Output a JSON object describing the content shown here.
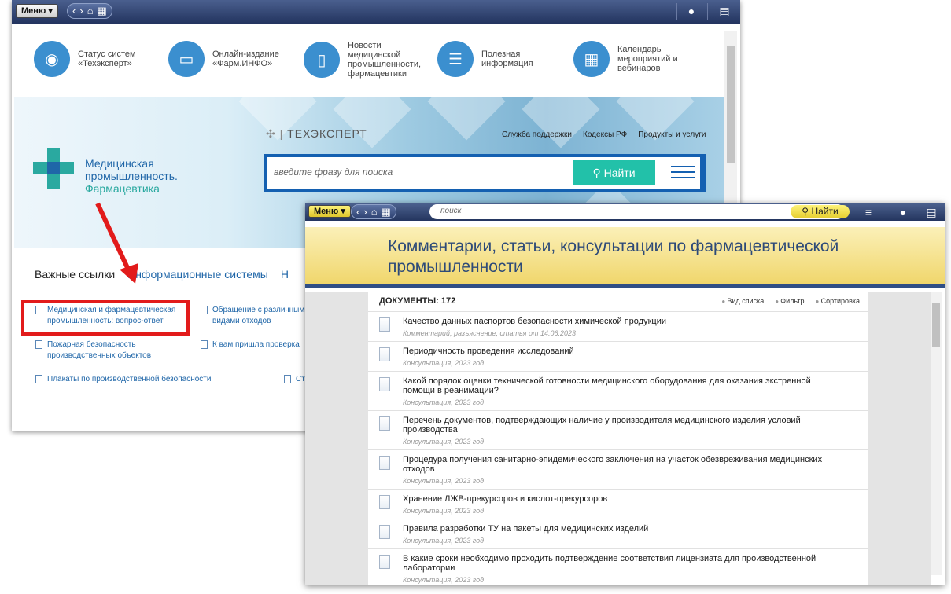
{
  "back": {
    "menu_label": "Меню",
    "quick": [
      {
        "text": "Статус систем «Техэксперт»",
        "icon": "rss-icon"
      },
      {
        "text": "Онлайн-издание «Фарм.ИНФО»",
        "icon": "monitor-icon"
      },
      {
        "text": "Новости медицинской промышленности, фармацевтики",
        "icon": "document-icon"
      },
      {
        "text": "Полезная информация",
        "icon": "clipboard-icon"
      },
      {
        "text": "Календарь мероприятий и вебинаров",
        "icon": "calendar-icon"
      }
    ],
    "logo_line1": "Медицинская",
    "logo_line2": "промышленность.",
    "logo_line3": "Фармацевтика",
    "brand": "ТЕХЭКСПЕРТ",
    "banner_links": [
      "Служба поддержки",
      "Кодексы РФ",
      "Продукты и услуги"
    ],
    "search_placeholder": "введите фразу для поиска",
    "search_button": "Найти",
    "tabs": [
      "Важные ссылки",
      "Информационные системы",
      "Н"
    ],
    "links": [
      "Медицинская и фармацевтическая промышленность: вопрос-ответ",
      "Обращение с различными видами отходов",
      "Пожарная безопасность производственных объектов",
      "К вам пришла проверка",
      "Плакаты по производственной безопасности",
      "Ст"
    ]
  },
  "front": {
    "menu_label": "Меню",
    "search_placeholder": "поиск",
    "search_button": "Найти",
    "title": "Комментарии, статьи, консультации по фармацевтической промышленности",
    "documents_label": "ДОКУМЕНТЫ: 172",
    "tools": [
      "Вид списка",
      "Фильтр",
      "Сортировка"
    ],
    "docs": [
      {
        "title": "Качество данных паспортов безопасности химической продукции",
        "meta": "Комментарий, разъяснение, статья от 14.06.2023"
      },
      {
        "title": "Периодичность проведения исследований",
        "meta": "Консультация, 2023 год"
      },
      {
        "title": "Какой порядок оценки технической готовности медицинского оборудования для оказания экстренной помощи в реанимации?",
        "meta": "Консультация, 2023 год"
      },
      {
        "title": "Перечень документов, подтверждающих наличие у производителя медицинского изделия условий производства",
        "meta": "Консультация, 2023 год"
      },
      {
        "title": "Процедура получения санитарно-эпидемического заключения на участок обезвреживания медицинских отходов",
        "meta": "Консультация, 2023 год"
      },
      {
        "title": "Хранение ЛЖВ-прекурсоров и кислот-прекурсоров",
        "meta": "Консультация, 2023 год"
      },
      {
        "title": "Правила разработки ТУ на пакеты для медицинских изделий",
        "meta": "Консультация, 2023 год"
      },
      {
        "title": "В какие сроки необходимо проходить подтверждение соответствия лицензиата для производственной лаборатории",
        "meta": "Консультация, 2023 год"
      }
    ]
  }
}
